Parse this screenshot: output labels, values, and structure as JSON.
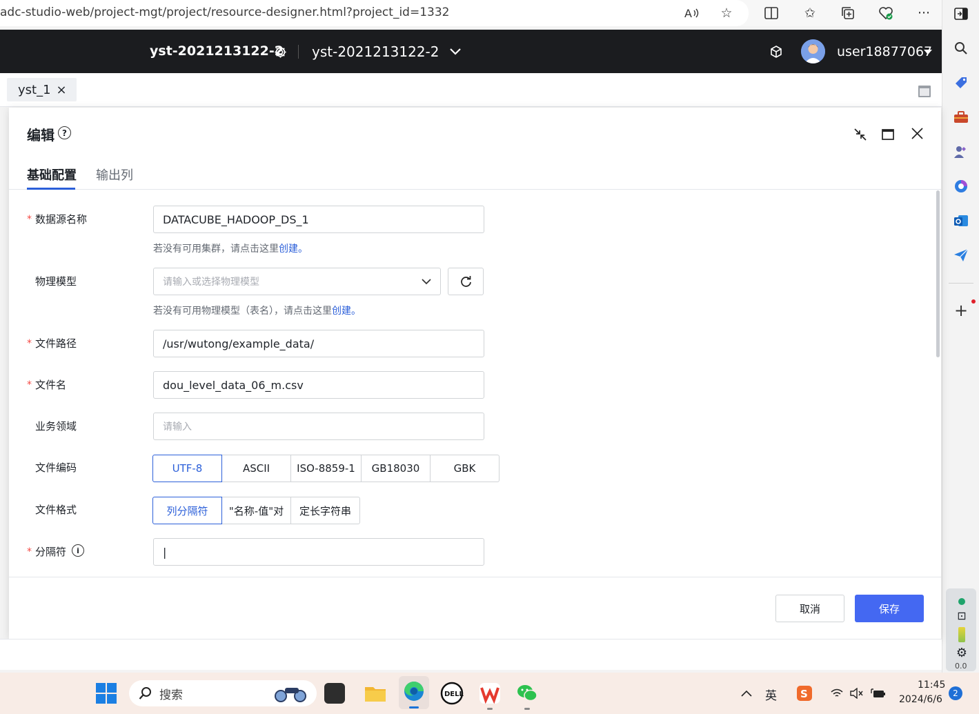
{
  "browser": {
    "url": "adc-studio-web/project-mgt/project/resource-designer.html?project_id=1332",
    "icons": [
      "read-aloud-icon",
      "favorite-star-icon",
      "split-screen-icon",
      "favorites-icon",
      "collections-icon",
      "browser-health-icon",
      "more-menu-icon",
      "sidebar-toggle-icon"
    ]
  },
  "header": {
    "project_name": "yst-2021213122-2",
    "workspace_select": "yst-2021213122-2",
    "username": "user18877067"
  },
  "tabstrip": {
    "tab_label": "yst_1",
    "close_glyph": "×"
  },
  "modal": {
    "title": "编辑",
    "tabs": [
      "基础配置",
      "输出列"
    ],
    "required_mark": "*",
    "fields": {
      "datasource_label": "数据源名称",
      "datasource_value": "DATACUBE_HADOOP_DS_1",
      "datasource_hint": "若没有可用集群，请点击这里",
      "datasource_hint_link": "创建。",
      "model_label": "物理模型",
      "model_placeholder": "请输入或选择物理模型",
      "model_hint": "若没有可用物理模型（表名），请点击这里",
      "model_hint_link": "创建。",
      "path_label": "文件路径",
      "path_value": "/usr/wutong/example_data/",
      "filename_label": "文件名",
      "filename_value": "dou_level_data_06_m.csv",
      "domain_label": "业务领域",
      "domain_placeholder": "请输入",
      "encoding_label": "文件编码",
      "encoding_options": [
        "UTF-8",
        "ASCII",
        "ISO-8859-1",
        "GB18030",
        "GBK"
      ],
      "encoding_selected": "UTF-8",
      "format_label": "文件格式",
      "format_options": [
        "列分隔符",
        "\"名称-值\"对",
        "定长字符串"
      ],
      "format_selected": "列分隔符",
      "delimiter_label": "分隔符",
      "delimiter_value": "|"
    },
    "buttons": {
      "cancel": "取消",
      "save": "保存"
    }
  },
  "taskbar": {
    "search_label": "搜索",
    "ime_label": "英",
    "time": "11:45",
    "date": "2024/6/6",
    "notification_count": "2"
  },
  "sidebar": {
    "perf_value": "0.0"
  },
  "colors": {
    "primary": "#4468f2",
    "link": "#2b5fd9",
    "header_bg": "#1b1c1f",
    "required": "#f54a45"
  }
}
